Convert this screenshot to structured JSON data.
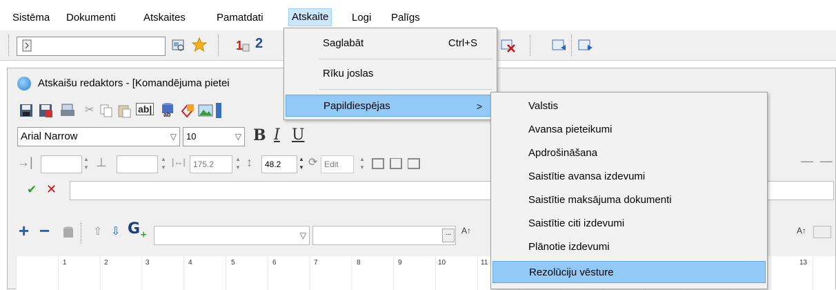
{
  "menubar": {
    "items": [
      "Sistēma",
      "Dokumenti",
      "Atskaites",
      "Pamatdati",
      "Atskaite",
      "Logi",
      "Palīgs"
    ],
    "active_index": 4
  },
  "window": {
    "title": "Atskaišu redaktors - [Komandējuma pietei"
  },
  "format_bar": {
    "font_name": "Arial Narrow",
    "font_size": "10",
    "bold": "B",
    "italic": "I",
    "underline": "U"
  },
  "position_bar": {
    "width_value": "175.2",
    "height_value": "48.2",
    "edit_placeholder": "Edit"
  },
  "ruler": {
    "marks": [
      "1",
      "2",
      "3",
      "4",
      "5",
      "6",
      "7",
      "8",
      "9",
      "10",
      "11",
      "13"
    ]
  },
  "atskaite_menu": {
    "items": [
      {
        "label": "Saglabāt",
        "accel": "Ctrl+S"
      },
      {
        "label": "Rīku joslas",
        "accel": ""
      },
      {
        "label": "Papildiespējas",
        "accel": "",
        "submenu_arrow": ">"
      }
    ],
    "highlighted_index": 2
  },
  "papildiespejas_submenu": {
    "items": [
      "Valstis",
      "Avansa pieteikumi",
      "Apdrošināšana",
      "Saistītie avansa izdevumi",
      "Saistītie maksājuma dokumenti",
      "Saistītie citi izdevumi",
      "Plānotie izdevumi",
      "Rezolūciju vēsture"
    ],
    "highlighted_index": 7
  },
  "colors": {
    "menu_highlight": "#91c9f7",
    "menubar_active": "#cce8ff",
    "confirm_check": "#2e9e2e",
    "cancel_x": "#d01010",
    "plus_blue": "#1e5fc2"
  }
}
